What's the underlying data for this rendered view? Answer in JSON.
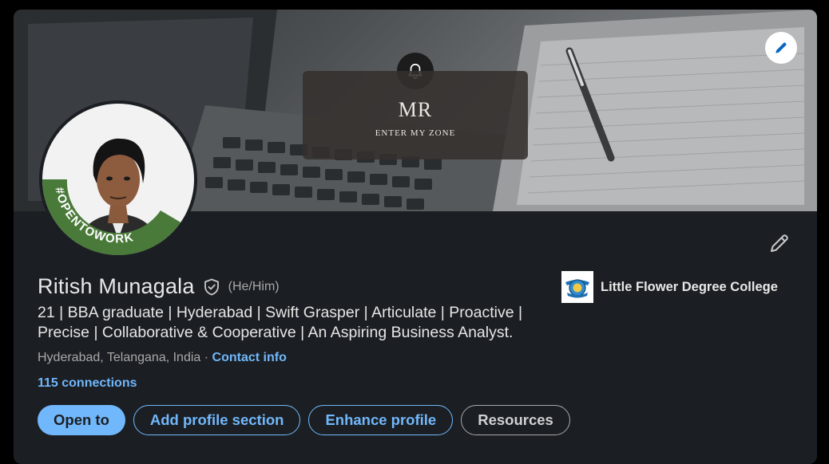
{
  "banner": {
    "bell_icon": "bell-icon",
    "monogram": "MR",
    "tagline": "ENTER MY ZONE",
    "edit_icon": "pencil-icon"
  },
  "avatar": {
    "frame_text": "#OPENTOWORK",
    "frame_color": "#4a7a3a"
  },
  "profile": {
    "name": "Ritish Munagala",
    "verified_icon": "verified-shield-icon",
    "pronouns": "(He/Him)",
    "headline": "21 | BBA graduate | Hyderabad | Swift Grasper | Articulate | Proactive | Precise | Collaborative & Cooperative | An Aspiring Business Analyst.",
    "location": "Hyderabad, Telangana, India",
    "separator": " · ",
    "contact_info": "Contact info",
    "connections": "115 connections",
    "edit_icon": "pencil-icon"
  },
  "education": {
    "school": "Little Flower Degree College",
    "logo_icon": "college-crest-icon"
  },
  "actions": {
    "open_to": "Open to",
    "add_section": "Add profile section",
    "enhance": "Enhance profile",
    "resources": "Resources"
  },
  "colors": {
    "accent": "#71b7fb",
    "card_bg": "#1b1f23",
    "page_bg": "#000000",
    "open_to_work_green": "#4a7a3a"
  }
}
